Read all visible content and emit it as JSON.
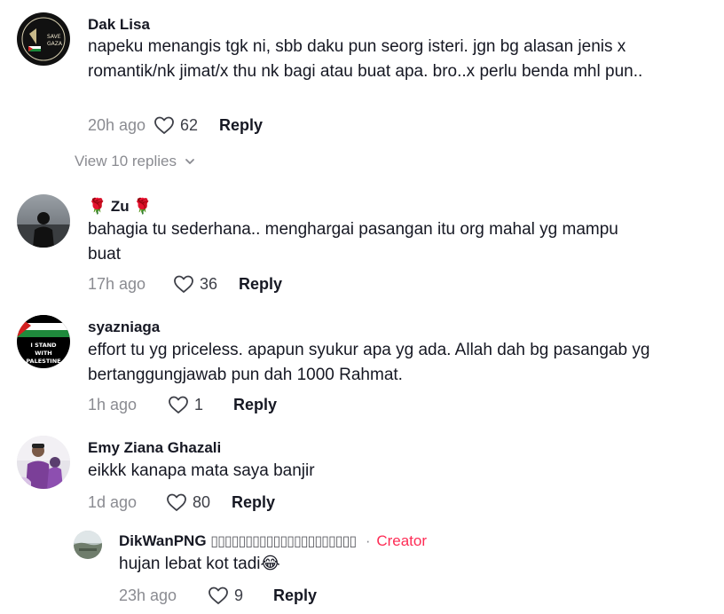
{
  "view_replies_label": "View 10 replies",
  "comments": [
    {
      "username": "Dak Lisa",
      "text": "napeku menangis tgk ni, sbb daku pun seorg isteri. jgn bg alasan jenis x romantik/nk jimat/x thu nk bagi atau buat apa. bro..x perlu benda mhl pun..",
      "time": "20h ago",
      "likes": "62",
      "reply_label": "Reply",
      "avatar_text_1": "SAVE",
      "avatar_text_2": "GAZA"
    },
    {
      "username_prefix": "🌹",
      "username": "Zu",
      "username_suffix": "🌹",
      "text": "bahagia tu sederhana.. menghargai pasangan itu org mahal yg mampu buat",
      "time": "17h ago",
      "likes": "36",
      "reply_label": "Reply"
    },
    {
      "username": "syazniaga",
      "text": "effort tu yg priceless. apapun syukur apa yg ada. Allah dah bg pasangab yg bertanggungjawab pun dah 1000 Rahmat.",
      "time": "1h ago",
      "likes": "1",
      "reply_label": "Reply",
      "avatar_text_1": "I STAND",
      "avatar_text_2": "WITH",
      "avatar_text_3": "PALESTINE"
    },
    {
      "username": "Emy Ziana Ghazali",
      "text": "eikkk kanapa mata saya banjir",
      "time": "1d ago",
      "likes": "80",
      "reply_label": "Reply"
    }
  ],
  "reply": {
    "username": "DikWanPNG",
    "username_extra": "▯▯▯▯▯▯▯▯▯▯▯▯▯▯▯▯▯▯▯▯▯",
    "separator": "·",
    "badge": "Creator",
    "text": "hujan lebat kot tadi😂",
    "time": "23h ago",
    "likes": "9",
    "reply_label": "Reply"
  },
  "colors": {
    "text": "#161823",
    "muted": "#8a8b91",
    "creator": "#fe2c55"
  }
}
